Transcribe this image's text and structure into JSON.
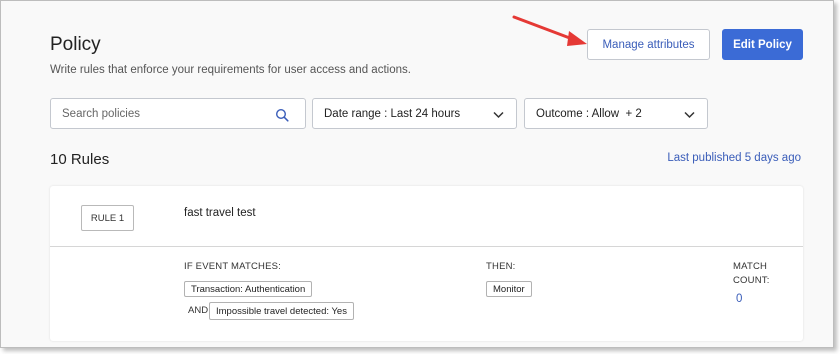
{
  "header": {
    "title": "Policy",
    "subtitle": "Write rules that enforce your requirements for user access and actions.",
    "manage_attributes_label": "Manage attributes",
    "edit_policy_label": "Edit Policy"
  },
  "filters": {
    "search_placeholder": "Search policies",
    "date_range": "Date range : Last 24 hours",
    "outcome": "Outcome : Allow  + 2"
  },
  "rules_summary": {
    "count_label": "10 Rules",
    "last_published": "Last published 5 days ago"
  },
  "rule": {
    "tag": "RULE 1",
    "name": "fast travel test",
    "if_label": "IF EVENT MATCHES:",
    "conditions": [
      "Transaction: Authentication",
      "Impossible travel detected: Yes"
    ],
    "and_label": "AND",
    "then_label": "THEN:",
    "action": "Monitor",
    "match_label_line1": "MATCH",
    "match_label_line2": "COUNT:",
    "match_count": "0"
  },
  "colors": {
    "accent": "#3b6bd6",
    "link": "#3a5db9",
    "annotation_arrow": "#e53935"
  }
}
